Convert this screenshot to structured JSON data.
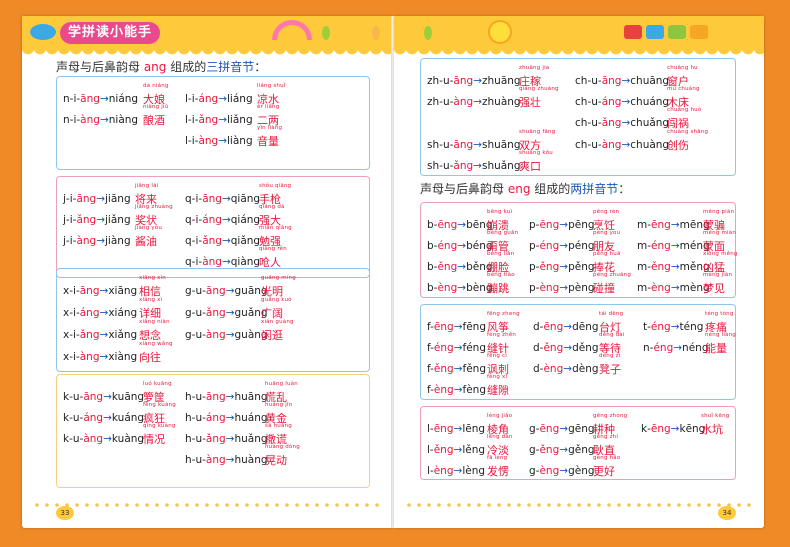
{
  "left": {
    "logo": "学拼读小能手",
    "heading": {
      "pre": "声母与后鼻韵母 ",
      "hl": "ang",
      "mid": " 组成的",
      "bl": "三拼音节",
      "post": "："
    },
    "page_number": "33",
    "boxes": [
      {
        "entries": [
          [
            "n",
            "i",
            "āng",
            "niāng",
            "niáng",
            "大娘",
            "dà niáng"
          ],
          [
            "n",
            "i",
            "àng",
            "niàng",
            "niàng",
            "酿酒",
            "niàng jiǔ"
          ],
          [
            "l",
            "i",
            "áng",
            "liáng",
            "liáng",
            "凉水",
            "liáng shuǐ"
          ],
          [
            "l",
            "i",
            "ǎng",
            "liǎng",
            "liǎng",
            "二两",
            "èr liǎng"
          ],
          [
            "l",
            "i",
            "àng",
            "liàng",
            "liàng",
            "音量",
            "yīn liàng"
          ]
        ]
      },
      {
        "entries": [
          [
            "j",
            "i",
            "āng",
            "jiāng",
            "jiāng",
            "将来",
            "jiāng lái"
          ],
          [
            "j",
            "i",
            "ǎng",
            "jiǎng",
            "jiǎng",
            "奖状",
            "jiǎng zhuàng"
          ],
          [
            "j",
            "i",
            "àng",
            "jiàng",
            "jiàng",
            "酱油",
            "jiàng yóu"
          ],
          [
            "q",
            "i",
            "āng",
            "qiāng",
            "qiāng",
            "手枪",
            "shǒu qiāng"
          ],
          [
            "q",
            "i",
            "áng",
            "qiáng",
            "qiáng",
            "强大",
            "qiáng dà"
          ],
          [
            "q",
            "i",
            "ǎng",
            "qiǎng",
            "qiǎng",
            "勉强",
            "miǎn qiǎng"
          ],
          [
            "q",
            "i",
            "àng",
            "qiàng",
            "qiàng",
            "呛人",
            "qiàng rén"
          ]
        ]
      },
      {
        "entries": [
          [
            "x",
            "i",
            "āng",
            "xiāng",
            "xiāng",
            "相信",
            "xiāng xìn"
          ],
          [
            "x",
            "i",
            "áng",
            "xiáng",
            "xiáng",
            "详细",
            "xiáng xì"
          ],
          [
            "x",
            "i",
            "ǎng",
            "xiǎng",
            "xiǎng",
            "想念",
            "xiǎng niàn"
          ],
          [
            "x",
            "i",
            "àng",
            "xiàng",
            "xiàng",
            "向往",
            "xiàng wǎng"
          ],
          [
            "g",
            "u",
            "āng",
            "guāng",
            "guāng",
            "光明",
            "guāng míng"
          ],
          [
            "g",
            "u",
            "ǎng",
            "guǎng",
            "guǎng",
            "广阔",
            "guǎng kuò"
          ],
          [
            "g",
            "u",
            "àng",
            "guàng",
            "guàng",
            "闲逛",
            "xián guàng"
          ]
        ]
      },
      {
        "entries": [
          [
            "k",
            "u",
            "āng",
            "kuāng",
            "kuāng",
            "箩筐",
            "luó kuāng"
          ],
          [
            "k",
            "u",
            "áng",
            "kuáng",
            "kuáng",
            "疯狂",
            "fēng kuáng"
          ],
          [
            "k",
            "u",
            "àng",
            "kuàng",
            "kuàng",
            "情况",
            "qíng kuàng"
          ],
          [
            "h",
            "u",
            "āng",
            "huāng",
            "huāng",
            "慌乱",
            "huāng luàn"
          ],
          [
            "h",
            "u",
            "áng",
            "huáng",
            "huáng",
            "黄金",
            "huáng jīn"
          ],
          [
            "h",
            "u",
            "ǎng",
            "huǎng",
            "huǎng",
            "撒谎",
            "sā huǎng"
          ],
          [
            "h",
            "u",
            "àng",
            "huàng",
            "huàng",
            "晃动",
            "huàng dòng"
          ]
        ]
      }
    ]
  },
  "right": {
    "heading": {
      "pre": "声母与后鼻韵母 ",
      "hl": "eng",
      "mid": " 组成的",
      "bl": "两拼音节",
      "post": "："
    },
    "page_number": "34",
    "top_box": [
      [
        "zh",
        "u",
        "āng",
        "zhuāng",
        "zhuāng",
        "庄稼",
        "zhuāng jia"
      ],
      [
        "zh",
        "u",
        "àng",
        "zhuàng",
        "zhuàng",
        "强壮",
        "qiáng zhuàng"
      ],
      [
        "sh",
        "u",
        "āng",
        "shuāng",
        "shuāng",
        "双方",
        "shuāng fāng"
      ],
      [
        "sh",
        "u",
        "ǎng",
        "shuǎng",
        "shuǎng",
        "爽口",
        "shuǎng kǒu"
      ],
      [
        "ch",
        "u",
        "āng",
        "chuāng",
        "chuāng",
        "窗户",
        "chuāng hu"
      ],
      [
        "ch",
        "u",
        "áng",
        "chuáng",
        "chuáng",
        "木床",
        "mù chuáng"
      ],
      [
        "ch",
        "u",
        "ǎng",
        "chuǎng",
        "chuǎng",
        "闯祸",
        "chuǎng huò"
      ],
      [
        "ch",
        "u",
        "àng",
        "chuàng",
        "chuàng",
        "创伤",
        "chuàng shāng"
      ]
    ],
    "boxes": [
      {
        "entries": [
          [
            "b",
            "ēng",
            "bēng",
            "崩溃",
            "bēng kuì"
          ],
          [
            "b",
            "éng",
            "béng",
            "甭管",
            "béng guǎn"
          ],
          [
            "b",
            "ěng",
            "běng",
            "绷脸",
            "běng liǎn"
          ],
          [
            "b",
            "èng",
            "bèng",
            "蹦跳",
            "bèng tiào"
          ],
          [
            "p",
            "ēng",
            "pēng",
            "烹饪",
            "pēng rèn"
          ],
          [
            "p",
            "éng",
            "péng",
            "朋友",
            "péng you"
          ],
          [
            "p",
            "ěng",
            "pěng",
            "捧花",
            "pěng huā"
          ],
          [
            "p",
            "èng",
            "pèng",
            "碰撞",
            "pèng zhuàng"
          ],
          [
            "m",
            "ēng",
            "mēng",
            "蒙骗",
            "mēng piàn"
          ],
          [
            "m",
            "éng",
            "méng",
            "蒙面",
            "méng miàn"
          ],
          [
            "m",
            "ěng",
            "měng",
            "凶猛",
            "xiōng měng"
          ],
          [
            "m",
            "èng",
            "mèng",
            "梦见",
            "mèng jiàn"
          ]
        ]
      },
      {
        "entries": [
          [
            "f",
            "ēng",
            "fēng",
            "风筝",
            "fēng zheng"
          ],
          [
            "f",
            "éng",
            "féng",
            "缝针",
            "féng zhēn"
          ],
          [
            "f",
            "ěng",
            "fěng",
            "讽刺",
            "fěng cì"
          ],
          [
            "f",
            "èng",
            "fèng",
            "缝隙",
            "fèng xì"
          ],
          [
            "d",
            "ēng",
            "dēng",
            "台灯",
            "tái dēng"
          ],
          [
            "d",
            "ěng",
            "děng",
            "等待",
            "děng dài"
          ],
          [
            "d",
            "èng",
            "dèng",
            "凳子",
            "dèng zi"
          ],
          [
            "t",
            "éng",
            "téng",
            "疼痛",
            "téng tòng"
          ],
          [
            "n",
            "éng",
            "néng",
            "能量",
            "néng liàng"
          ]
        ]
      },
      {
        "entries": [
          [
            "l",
            "ēng",
            "lēng",
            "棱角",
            "léng jiǎo"
          ],
          [
            "l",
            "ěng",
            "lěng",
            "冷淡",
            "lěng dàn"
          ],
          [
            "l",
            "èng",
            "lèng",
            "发愣",
            "fā lèng"
          ],
          [
            "g",
            "ēng",
            "gēng",
            "耕种",
            "gēng zhòng"
          ],
          [
            "g",
            "ěng",
            "gěng",
            "耿直",
            "gěng zhí"
          ],
          [
            "g",
            "èng",
            "gèng",
            "更好",
            "gèng hǎo"
          ],
          [
            "k",
            "ēng",
            "kēng",
            "水坑",
            "shuǐ kēng"
          ]
        ]
      }
    ]
  }
}
